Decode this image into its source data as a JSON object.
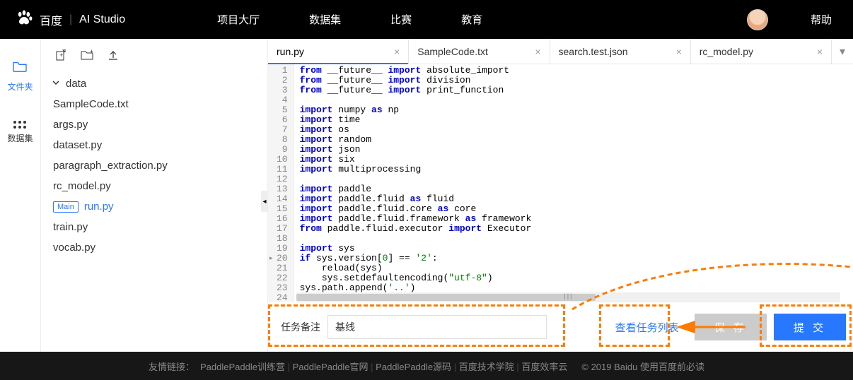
{
  "header": {
    "logo_text": "百度",
    "logo_suffix": "AI Studio",
    "nav": [
      "项目大厅",
      "数据集",
      "比赛",
      "教育"
    ],
    "help": "帮助"
  },
  "rail": {
    "files": "文件夹",
    "datasets": "数据集"
  },
  "filetree": {
    "root": "data",
    "files": [
      {
        "name": "SampleCode.txt",
        "main": false
      },
      {
        "name": "args.py",
        "main": false
      },
      {
        "name": "dataset.py",
        "main": false
      },
      {
        "name": "paragraph_extraction.py",
        "main": false
      },
      {
        "name": "rc_model.py",
        "main": false
      },
      {
        "name": "run.py",
        "main": true
      },
      {
        "name": "train.py",
        "main": false
      },
      {
        "name": "vocab.py",
        "main": false
      }
    ],
    "main_badge": "Main"
  },
  "tabs": [
    {
      "label": "run.py",
      "active": true
    },
    {
      "label": "SampleCode.txt",
      "active": false
    },
    {
      "label": "search.test.json",
      "active": false
    },
    {
      "label": "rc_model.py",
      "active": false
    }
  ],
  "code": {
    "lines": [
      {
        "n": 1,
        "html": "<span class='kw'>from</span> __future__ <span class='kw'>import</span> absolute_import"
      },
      {
        "n": 2,
        "html": "<span class='kw'>from</span> __future__ <span class='kw'>import</span> division"
      },
      {
        "n": 3,
        "html": "<span class='kw'>from</span> __future__ <span class='kw'>import</span> print_function"
      },
      {
        "n": 4,
        "html": ""
      },
      {
        "n": 5,
        "html": "<span class='kw'>import</span> numpy <span class='kw'>as</span> np"
      },
      {
        "n": 6,
        "html": "<span class='kw'>import</span> time"
      },
      {
        "n": 7,
        "html": "<span class='kw'>import</span> os"
      },
      {
        "n": 8,
        "html": "<span class='kw'>import</span> random"
      },
      {
        "n": 9,
        "html": "<span class='kw'>import</span> json"
      },
      {
        "n": 10,
        "html": "<span class='kw'>import</span> six"
      },
      {
        "n": 11,
        "html": "<span class='kw'>import</span> multiprocessing"
      },
      {
        "n": 12,
        "html": ""
      },
      {
        "n": 13,
        "html": "<span class='kw'>import</span> paddle"
      },
      {
        "n": 14,
        "html": "<span class='kw'>import</span> paddle.fluid <span class='kw'>as</span> fluid"
      },
      {
        "n": 15,
        "html": "<span class='kw'>import</span> paddle.fluid.core <span class='kw'>as</span> core"
      },
      {
        "n": 16,
        "html": "<span class='kw'>import</span> paddle.fluid.framework <span class='kw'>as</span> framework"
      },
      {
        "n": 17,
        "html": "<span class='kw'>from</span> paddle.fluid.executor <span class='kw'>import</span> Executor"
      },
      {
        "n": 18,
        "html": ""
      },
      {
        "n": 19,
        "html": "<span class='kw'>import</span> sys"
      },
      {
        "n": 20,
        "html": "<span class='kw'>if</span> sys.version[<span class='num'>0</span>] == <span class='st'>'2'</span>:",
        "marked": true
      },
      {
        "n": 21,
        "html": "    reload(sys)"
      },
      {
        "n": 22,
        "html": "    sys.setdefaultencoding(<span class='st'>\"utf-8\"</span>)"
      },
      {
        "n": 23,
        "html": "sys.path.append(<span class='st'>'..'</span>)"
      },
      {
        "n": 24,
        "html": ""
      }
    ]
  },
  "bottom": {
    "task_label": "任务备注",
    "task_value": "基线",
    "view_tasks": "查看任务列表",
    "save": "保 存",
    "submit": "提 交"
  },
  "footer": {
    "prefix": "友情链接：",
    "links": [
      "PaddlePaddle训练营",
      "PaddlePaddle官网",
      "PaddlePaddle源码",
      "百度技术学院",
      "百度效率云"
    ],
    "copyright": "© 2019 Baidu 使用百度前必读"
  }
}
